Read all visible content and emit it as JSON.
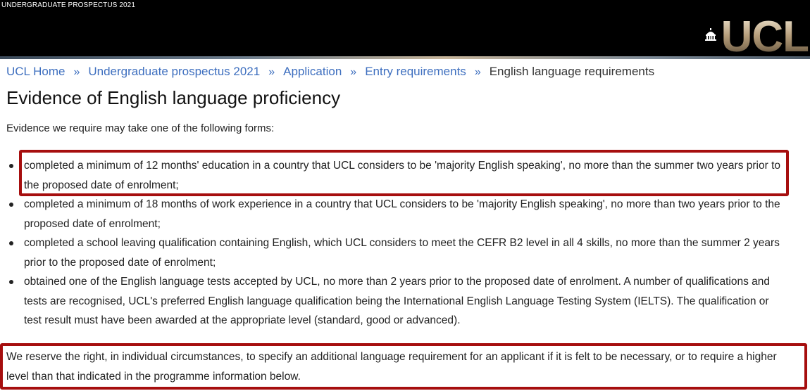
{
  "header": {
    "prospectus_label": "UNDERGRADUATE PROSPECTUS 2021",
    "logo_text": "UCL",
    "logo_icon": "portico-dome-icon"
  },
  "breadcrumb": {
    "items": [
      {
        "label": "UCL Home"
      },
      {
        "label": "Undergraduate prospectus 2021"
      },
      {
        "label": "Application"
      },
      {
        "label": "Entry requirements"
      }
    ],
    "separator": "»",
    "current": "English language requirements"
  },
  "main": {
    "title": "Evidence of English language proficiency",
    "intro": "Evidence we require may take one of the following forms:",
    "evidence_items": [
      "completed a minimum of 12 months' education in a country that UCL considers to be 'majority English speaking', no more than the summer two years prior to the proposed date of enrolment;",
      "completed a minimum of 18 months of work experience in a country that UCL considers to be 'majority English speaking', no more than two years prior to the proposed date of enrolment;",
      "completed a school leaving qualification containing English, which UCL considers to meet the CEFR B2 level in all 4 skills, no more than the summer 2 years prior to the proposed date of enrolment;",
      "obtained one of the English language tests accepted by UCL, no more than 2 years prior to the proposed date of enrolment. A number of qualifications and tests are recognised, UCL's preferred English language qualification being the International English Language Testing System (IELTS). The qualification or test result must have been awarded at the appropriate level (standard, good or advanced)."
    ],
    "reserve_note": "We reserve the right, in individual circumstances, to specify an additional language requirement for an applicant if it is felt to be necessary, or to require a higher level than that indicated in the programme information below."
  },
  "colors": {
    "header_bg": "#000000",
    "link": "#3e6fbf",
    "highlight_border": "#a60e0e"
  }
}
